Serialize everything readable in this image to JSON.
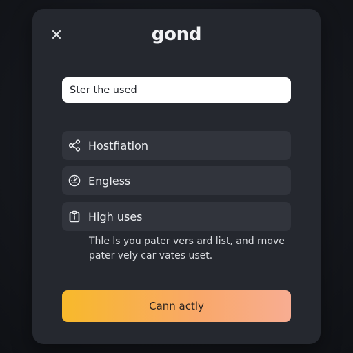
{
  "dialog": {
    "title": "gond",
    "close_icon": "close-icon"
  },
  "search": {
    "value": "Ster the used"
  },
  "options": [
    {
      "icon": "share-icon",
      "label": "Hostfiation"
    },
    {
      "icon": "dashboard-gauge-icon",
      "label": "Engless"
    },
    {
      "icon": "clipboard-info-icon",
      "label": "High uses"
    }
  ],
  "description": {
    "line1": "Thle ls you pater vers ard list, and rnove",
    "line2": "pater vely car vates uset."
  },
  "cta": {
    "label": "Cann actly"
  },
  "colors": {
    "background": "#121419",
    "dialog": "#25282f",
    "option_bg": "#31343c",
    "cta_start": "#f8b92b",
    "cta_end": "#f8ad92"
  }
}
